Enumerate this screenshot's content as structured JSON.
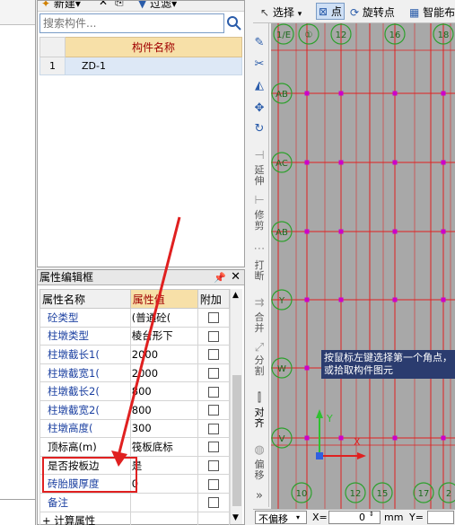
{
  "colors": {
    "grid_line": "#e02020",
    "grid_axis_bubble": "#2da02d",
    "node_point": "#cc00cc",
    "canvas_bg": "#a8a8a8",
    "tip_bg": "#2b3c6f",
    "highlight": "#e02020"
  },
  "top_toolbar": {
    "new_label": "新建",
    "filter_label": "过滤"
  },
  "component_list": {
    "search_placeholder": "搜索构件...",
    "column_header": "构件名称",
    "rows": [
      {
        "index": "1",
        "name": "ZD-1"
      }
    ]
  },
  "property_panel": {
    "title": "属性编辑框",
    "pin_icon": "pin-icon",
    "close_icon": "close-icon",
    "headers": {
      "name": "属性名称",
      "value": "属性值",
      "extra": "附加"
    },
    "rows": [
      {
        "name": "砼类型",
        "value": "(普通砼(",
        "link": true
      },
      {
        "name": "柱墩类型",
        "value": "棱台形下",
        "link": true
      },
      {
        "name": "柱墩截长1(",
        "value": "2000",
        "link": true
      },
      {
        "name": "柱墩截宽1(",
        "value": "2000",
        "link": true
      },
      {
        "name": "柱墩截长2(",
        "value": "800",
        "link": true
      },
      {
        "name": "柱墩截宽2(",
        "value": "800",
        "link": true
      },
      {
        "name": "柱墩高度(",
        "value": "300",
        "link": true
      },
      {
        "name": "顶标高(m)",
        "value": "筏板底标",
        "link": false
      },
      {
        "name": "是否按板边",
        "value": "是",
        "link": false
      },
      {
        "name": "砖胎膜厚度",
        "value": "0",
        "link": true
      },
      {
        "name": "备注",
        "value": "",
        "link": true
      },
      {
        "name": "+ 计算属性",
        "value": "",
        "link": false
      }
    ]
  },
  "main_toolbar": {
    "select_label": "选择",
    "point_label": "点",
    "rotate_point_label": "旋转点",
    "smart_label": "智能布"
  },
  "vertical_toolbar": {
    "extend_label": "延伸",
    "trim_label": "修剪",
    "break_label": "打断",
    "merge_label": "合并",
    "split_label": "分割",
    "align_label": "对齐",
    "offset_label": "偏移"
  },
  "canvas": {
    "tip": "按鼠标左键选择第一个角点，或拾取构件图元",
    "top_axes": [
      "1/E",
      "①",
      "12",
      "16",
      "18"
    ],
    "left_axes": [
      "1/E",
      "AB",
      "AC",
      "AB",
      "Y",
      "W",
      "V"
    ],
    "bottom_axes": [
      "10",
      "12",
      "15",
      "17",
      "2"
    ],
    "axis_x_label": "X",
    "axis_y_label": "Y"
  },
  "statusbar": {
    "offset_mode": "不偏移",
    "x_label": "X=",
    "x_value": "0",
    "unit": "mm",
    "y_label": "Y="
  }
}
